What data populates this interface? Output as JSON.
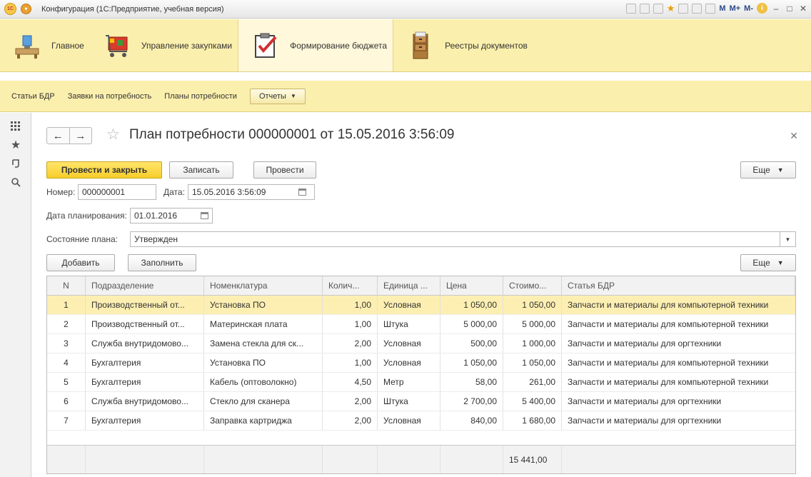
{
  "window": {
    "title": "Конфигурация (1С:Предприятие, учебная версия)",
    "tb_m": "M",
    "tb_mplus": "M+",
    "tb_mminus": "M-"
  },
  "sections": [
    {
      "label": "Главное",
      "icon": "main-desk-icon"
    },
    {
      "label": "Управление закупками",
      "icon": "shopping-cart-icon"
    },
    {
      "label": "Формирование бюджета",
      "icon": "checklist-icon"
    },
    {
      "label": "Реестры документов",
      "icon": "file-cabinet-icon"
    }
  ],
  "commands": {
    "links": [
      "Статьи БДР",
      "Заявки на потребность",
      "Планы потребности"
    ],
    "reports": "Отчеты"
  },
  "form": {
    "title": "План потребности 000000001 от 15.05.2016 3:56:09",
    "buttons": {
      "post_close": "Провести и закрыть",
      "save": "Записать",
      "post": "Провести",
      "more": "Еще"
    },
    "number_label": "Номер:",
    "number": "000000001",
    "date_label": "Дата:",
    "date": "15.05.2016  3:56:09",
    "plan_date_label": "Дата планирования:",
    "plan_date": "01.01.2016",
    "state_label": "Состояние плана:",
    "state": "Утвержден"
  },
  "table": {
    "buttons": {
      "add": "Добавить",
      "fill": "Заполнить",
      "more": "Еще"
    },
    "columns": [
      "N",
      "Подразделение",
      "Номенклатура",
      "Колич...",
      "Единица ...",
      "Цена",
      "Стоимо...",
      "Статья БДР"
    ],
    "rows": [
      [
        "1",
        "Производственный от...",
        "Установка ПО",
        "1,00",
        "Условная",
        "1 050,00",
        "1 050,00",
        "Запчасти и материалы для компьютерной техники"
      ],
      [
        "2",
        "Производственный от...",
        "Материнская плата",
        "1,00",
        "Штука",
        "5 000,00",
        "5 000,00",
        "Запчасти и материалы для компьютерной техники"
      ],
      [
        "3",
        "Служба внутридомово...",
        "Замена стекла для ск...",
        "2,00",
        "Условная",
        "500,00",
        "1 000,00",
        "Запчасти и материалы для оргтехники"
      ],
      [
        "4",
        "Бухгалтерия",
        "Установка ПО",
        "1,00",
        "Условная",
        "1 050,00",
        "1 050,00",
        "Запчасти и материалы для компьютерной техники"
      ],
      [
        "5",
        "Бухгалтерия",
        "Кабель (оптоволокно)",
        "4,50",
        "Метр",
        "58,00",
        "261,00",
        "Запчасти и материалы для компьютерной техники"
      ],
      [
        "6",
        "Служба внутридомово...",
        "Стекло для сканера",
        "2,00",
        "Штука",
        "2 700,00",
        "5 400,00",
        "Запчасти и материалы для оргтехники"
      ],
      [
        "7",
        "Бухгалтерия",
        "Заправка картриджа",
        "2,00",
        "Условная",
        "840,00",
        "1 680,00",
        "Запчасти и материалы для оргтехники"
      ]
    ],
    "total": "15 441,00"
  }
}
